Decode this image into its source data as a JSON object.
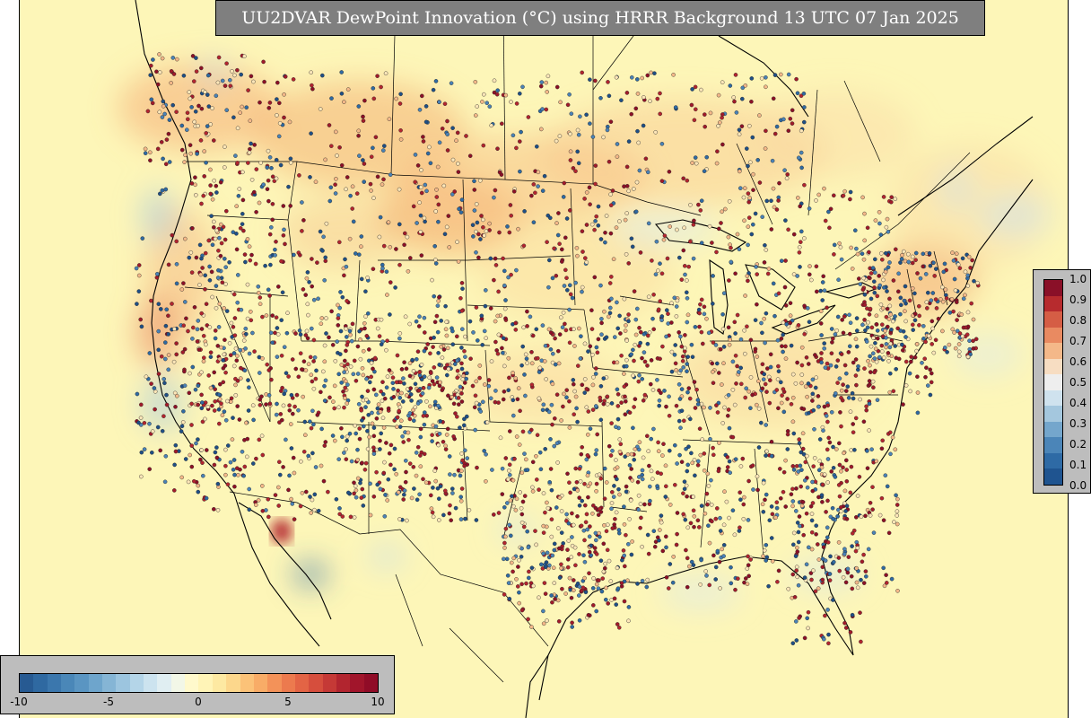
{
  "title": "UU2DVAR DewPoint Innovation (°C) using HRRR Background 13 UTC 07 Jan 2025",
  "map": {
    "ocean_color": "#fdf6b8",
    "land_color": "#fef4b4"
  },
  "fraction_legend": {
    "ticks": [
      "0.0",
      "0.1",
      "0.2",
      "0.3",
      "0.4",
      "0.5",
      "0.6",
      "0.7",
      "0.8",
      "0.9",
      "1.0"
    ],
    "colors": [
      "#1f5490",
      "#2e6aa5",
      "#4b85b8",
      "#74a6cc",
      "#a4c7de",
      "#cfe2ee",
      "#eeeeee",
      "#f7ddc2",
      "#f4b889",
      "#e98a61",
      "#d55d45",
      "#b72b2e",
      "#8a1028"
    ]
  },
  "innovation_legend": {
    "ticks": [
      "-10",
      "-5",
      "0",
      "5",
      "10"
    ],
    "colors": [
      "#275a92",
      "#2f69a1",
      "#3b77ad",
      "#4a87b8",
      "#5a95c2",
      "#6ea5cc",
      "#85b5d5",
      "#9cc5df",
      "#b4d5e8",
      "#cce3ef",
      "#e0eef2",
      "#f2f7e7",
      "#fff9cc",
      "#fff4b7",
      "#fde9a2",
      "#fcd78c",
      "#fbc278",
      "#f8ac67",
      "#f39259",
      "#ec7a4e",
      "#e36445",
      "#d64e3d",
      "#c53936",
      "#b2252f",
      "#a1152b",
      "#900c27"
    ]
  }
}
